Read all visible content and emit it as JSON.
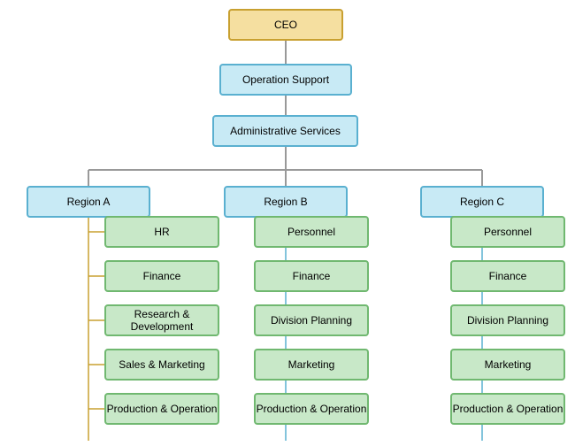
{
  "nodes": {
    "ceo": {
      "label": "CEO"
    },
    "opSupport": {
      "label": "Operation Support"
    },
    "adminServices": {
      "label": "Administrative Services"
    },
    "regionA": {
      "label": "Region A"
    },
    "regionB": {
      "label": "Region B"
    },
    "regionC": {
      "label": "Region C"
    },
    "a_hr": {
      "label": "HR"
    },
    "a_finance": {
      "label": "Finance"
    },
    "a_rd": {
      "label": "Research & Development"
    },
    "a_sm": {
      "label": "Sales & Marketing"
    },
    "a_po": {
      "label": "Production & Operation"
    },
    "b_personnel": {
      "label": "Personnel"
    },
    "b_finance": {
      "label": "Finance"
    },
    "b_dp": {
      "label": "Division Planning"
    },
    "b_marketing": {
      "label": "Marketing"
    },
    "b_po": {
      "label": "Production & Operation"
    },
    "c_personnel": {
      "label": "Personnel"
    },
    "c_finance": {
      "label": "Finance"
    },
    "c_dp": {
      "label": "Division Planning"
    },
    "c_marketing": {
      "label": "Marketing"
    },
    "c_po": {
      "label": "Production & Operation"
    }
  }
}
